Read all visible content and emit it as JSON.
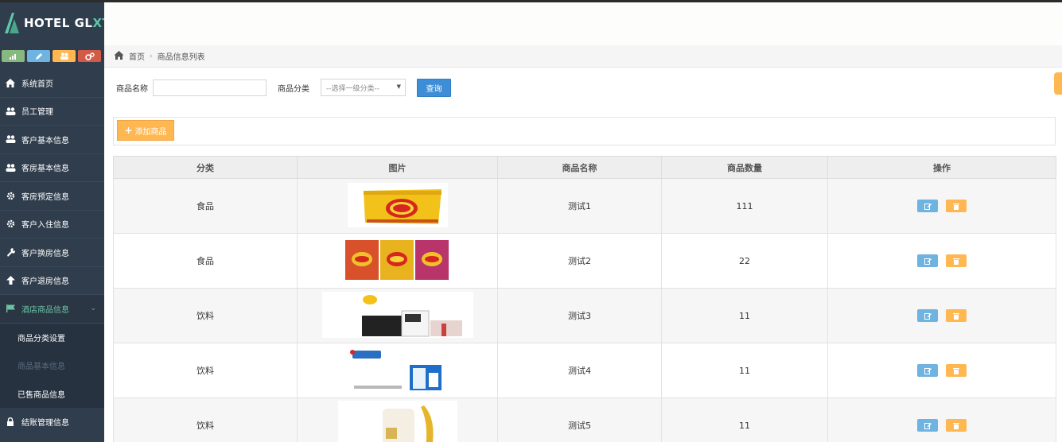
{
  "brand": {
    "name_main": "HOTEL GL",
    "name_accent": "XT"
  },
  "sidebar": {
    "items": [
      {
        "label": "系统首页",
        "icon": "home-icon"
      },
      {
        "label": "员工管理",
        "icon": "users-icon"
      },
      {
        "label": "客户基本信息",
        "icon": "users-icon"
      },
      {
        "label": "客房基本信息",
        "icon": "users-icon"
      },
      {
        "label": "客房预定信息",
        "icon": "gear-icon"
      },
      {
        "label": "客户入住信息",
        "icon": "gear-icon"
      },
      {
        "label": "客户换房信息",
        "icon": "wrench-icon"
      },
      {
        "label": "客户退房信息",
        "icon": "arrow-up-icon"
      },
      {
        "label": "酒店商品信息",
        "icon": "flag-icon"
      }
    ],
    "subitems": [
      {
        "label": "商品分类设置"
      },
      {
        "label": "商品基本信息"
      },
      {
        "label": "已售商品信息"
      }
    ],
    "bottom_item": {
      "label": "结账管理信息",
      "icon": "lock-icon"
    }
  },
  "breadcrumb": {
    "home": "首页",
    "current": "商品信息列表"
  },
  "search": {
    "name_label": "商品名称",
    "name_value": "",
    "category_label": "商品分类",
    "category_selected": "--选择一级分类--",
    "query_button": "查询"
  },
  "toolbar": {
    "add_button": "添加商品"
  },
  "table": {
    "headers": [
      "分类",
      "图片",
      "商品名称",
      "商品数量",
      "操作"
    ],
    "rows": [
      {
        "category": "食品",
        "image": "chips-bag",
        "name": "测试1",
        "quantity": "111"
      },
      {
        "category": "食品",
        "image": "chips-three-pack",
        "name": "测试2",
        "quantity": "22"
      },
      {
        "category": "饮料",
        "image": "milk-box",
        "name": "测试3",
        "quantity": "11"
      },
      {
        "category": "饮料",
        "image": "yogurt-pack",
        "name": "测试4",
        "quantity": "11"
      },
      {
        "category": "饮料",
        "image": "drink-bottle",
        "name": "测试5",
        "quantity": "11"
      }
    ]
  },
  "colors": {
    "sidebar_bg": "#2f3d4c",
    "active_text": "#6ec3a6",
    "primary": "#3d8ed6",
    "warning": "#ffb752",
    "info": "#6fb3e0"
  }
}
